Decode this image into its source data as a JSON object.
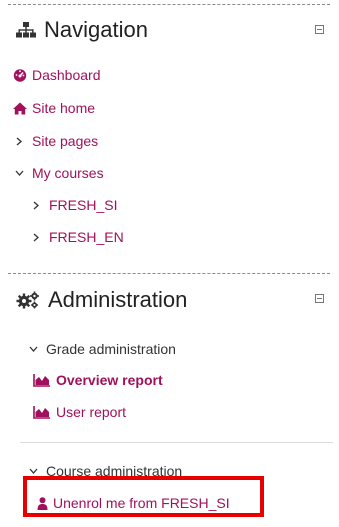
{
  "navigation": {
    "title": "Navigation",
    "items": [
      {
        "label": "Dashboard",
        "icon": "dashboard-icon"
      },
      {
        "label": "Site home",
        "icon": "home-icon"
      },
      {
        "label": "Site pages",
        "icon": "chevron-right-icon"
      },
      {
        "label": "My courses",
        "icon": "chevron-down-icon"
      },
      {
        "label": "FRESH_SI",
        "icon": "chevron-right-icon"
      },
      {
        "label": "FRESH_EN",
        "icon": "chevron-right-icon"
      }
    ]
  },
  "administration": {
    "title": "Administration",
    "grade_admin": {
      "label": "Grade administration"
    },
    "overview_report": {
      "label": "Overview report"
    },
    "user_report": {
      "label": "User report"
    },
    "course_admin": {
      "label": "Course administration"
    },
    "unenrol": {
      "label": "Unenrol me from FRESH_SI"
    }
  },
  "colors": {
    "link": "#a0105c",
    "highlight_border": "#e60000",
    "text": "#333333"
  }
}
